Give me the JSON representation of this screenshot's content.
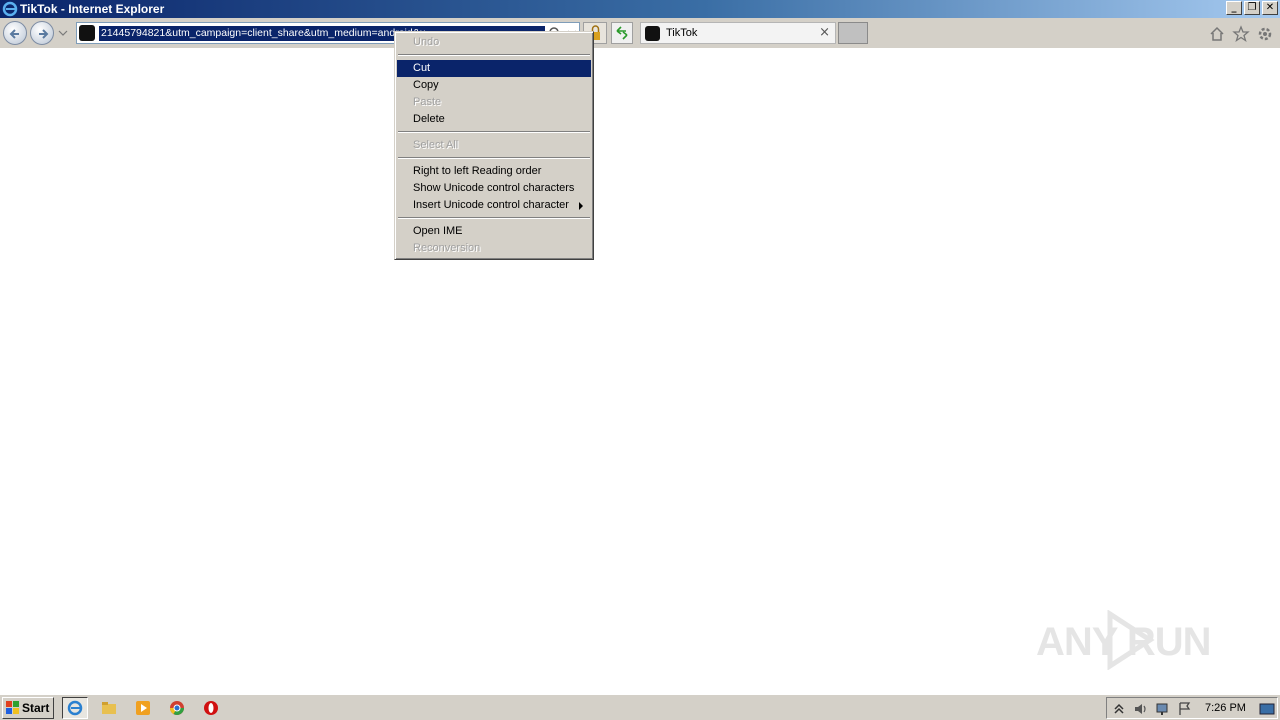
{
  "window": {
    "title": "TikTok - Internet Explorer",
    "controls": {
      "minimize": "_",
      "restore": "❐",
      "close": "✕"
    }
  },
  "toolbar": {
    "address_url": "21445794821&utm_campaign=client_share&utm_medium=android&u",
    "icons": [
      "back-icon",
      "forward-icon",
      "search-icon",
      "lock-icon",
      "refresh-icon",
      "home-icon",
      "favorites-icon",
      "tools-icon"
    ]
  },
  "tabs": [
    {
      "label": "TikTok",
      "close": "×"
    }
  ],
  "context_menu": {
    "items": [
      {
        "label": "Undo",
        "disabled": true
      },
      {
        "label": "Cut",
        "selected": true
      },
      {
        "label": "Copy"
      },
      {
        "label": "Paste",
        "disabled": true
      },
      {
        "label": "Delete"
      },
      {
        "label": "Select All",
        "disabled": true
      },
      {
        "label": "Right to left Reading order"
      },
      {
        "label": "Show Unicode control characters"
      },
      {
        "label": "Insert Unicode control character",
        "submenu": true
      },
      {
        "label": "Open IME"
      },
      {
        "label": "Reconversion",
        "disabled": true
      }
    ]
  },
  "watermark": {
    "text": "ANY RUN"
  },
  "taskbar": {
    "start_label": "Start",
    "clock": "7:26 PM"
  },
  "colors": {
    "selection": "#0a246a",
    "face": "#d4d0c8",
    "title_start": "#0a246a",
    "title_end": "#a6caf0"
  }
}
